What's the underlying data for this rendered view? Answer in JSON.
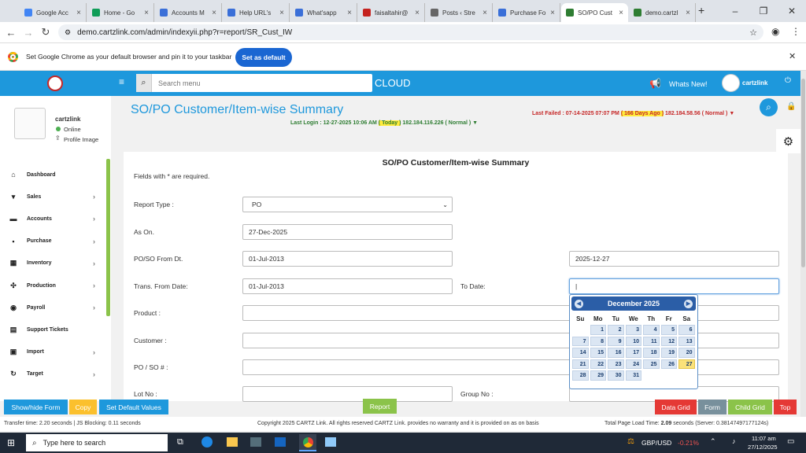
{
  "browser": {
    "tabs": [
      {
        "title": "Google Acc",
        "color": "#4285f4"
      },
      {
        "title": "Home - Go",
        "color": "#0f9d58"
      },
      {
        "title": "Accounts M",
        "color": "#3a6fd8"
      },
      {
        "title": "Help URL's",
        "color": "#3a6fd8"
      },
      {
        "title": "What'sapp",
        "color": "#3a6fd8"
      },
      {
        "title": "faisaltahir@",
        "color": "#c5221f"
      },
      {
        "title": "Posts ‹ Stre",
        "color": "#666666"
      },
      {
        "title": "Purchase Fo",
        "color": "#3a6fd8"
      },
      {
        "title": "SO/PO Cust",
        "color": "#2e7d32"
      },
      {
        "title": "demo.cartzl",
        "color": "#2e7d32"
      }
    ],
    "url": "demo.cartzlink.com/admin/indexyii.php?r=report/SR_Cust_IW",
    "infobar_text": "Set Google Chrome as your default browser and pin it to your taskbar",
    "infobar_button": "Set as default"
  },
  "header": {
    "search_placeholder": "Search menu",
    "cloud": "CLOUD",
    "whats_new": "Whats New!",
    "user": "cartzlink"
  },
  "profile": {
    "name": "cartzlink",
    "status": "Online",
    "image_link": "Profile Image"
  },
  "sidebar": {
    "items": [
      {
        "label": "Dashboard",
        "icon": "home-icon",
        "glyph": "⌂",
        "arrow": ""
      },
      {
        "label": "Sales",
        "icon": "cart-icon",
        "glyph": "▾",
        "arrow": "›"
      },
      {
        "label": "Accounts",
        "icon": "bank-icon",
        "glyph": "▬",
        "arrow": "›"
      },
      {
        "label": "Purchase",
        "icon": "truck-icon",
        "glyph": "▪",
        "arrow": "›"
      },
      {
        "label": "Inventory",
        "icon": "inventory-icon",
        "glyph": "▦",
        "arrow": "›"
      },
      {
        "label": "Production",
        "icon": "production-icon",
        "glyph": "✣",
        "arrow": "›"
      },
      {
        "label": "Payroll",
        "icon": "payroll-icon",
        "glyph": "◉",
        "arrow": "›"
      },
      {
        "label": "Support Tickets",
        "icon": "ticket-icon",
        "glyph": "▤",
        "arrow": ""
      },
      {
        "label": "Import",
        "icon": "import-icon",
        "glyph": "▣",
        "arrow": "›"
      },
      {
        "label": "Target",
        "icon": "target-icon",
        "glyph": "↻",
        "arrow": "›"
      }
    ]
  },
  "page": {
    "title": "SO/PO Customer/Item-wise Summary",
    "last_login_label": "Last Login : 12-27-2025 10:06 AM",
    "last_login_badge": "( Today )",
    "last_login_ip": "182.184.116.226 ( Normal ) ▼",
    "last_failed_label": "Last Failed : 07-14-2025 07:07 PM",
    "last_failed_badge": "( 166 Days Ago )",
    "last_failed_ip": "182.184.58.56 ( Normal ) ▼"
  },
  "form": {
    "heading": "SO/PO Customer/Item-wise Summary",
    "required_note": "Fields with * are required.",
    "report_type_label": "Report Type :",
    "report_type_value": "PO",
    "as_on_label": "As On.",
    "as_on_value": "27-Dec-2025",
    "poso_from_label": "PO/SO From Dt.",
    "poso_from_value": "01-Jul-2013",
    "poso_to_value": "2025-12-27",
    "trans_from_label": "Trans. From Date:",
    "trans_from_value": "01-Jul-2013",
    "to_date_label": "To Date:",
    "product_label": "Product :",
    "customer_label": "Customer :",
    "poso_no_label": "PO / SO # :",
    "lot_no_label": "Lot No :",
    "group_no_label": "Group No :"
  },
  "calendar": {
    "month": "December 2025",
    "dow": [
      "Su",
      "Mo",
      "Tu",
      "We",
      "Th",
      "Fr",
      "Sa"
    ],
    "first_weekday": 1,
    "days": 31,
    "today": 27
  },
  "buttons": {
    "show_hide": "Show/hide Form",
    "copy": "Copy",
    "set_default": "Set Default Values",
    "report": "Report",
    "data_grid": "Data Grid",
    "form": "Form",
    "child_grid": "Child Grid",
    "top": "Top"
  },
  "status": {
    "left": "Transfer time: 2.20 seconds  |  JS Blocking: 0.11 seconds",
    "center": "Copyright 2025 CARTZ Link. All rights reserved CARTZ Link. provides no warranty and it is provided on as on basis",
    "right_prefix": "Total Page Load Time:",
    "right_value": "2.09",
    "right_suffix": "seconds (Server: 0.38147497177124s)"
  },
  "taskbar": {
    "search": "Type here to search",
    "ticker": "GBP/USD",
    "change": "-0.21%",
    "time": "11:07 am",
    "date": "27/12/2025"
  },
  "colors": {
    "header": "#1e98dc",
    "title": "#1e98dc",
    "green_btn": "#8bc34a",
    "red_btn": "#e53935"
  }
}
